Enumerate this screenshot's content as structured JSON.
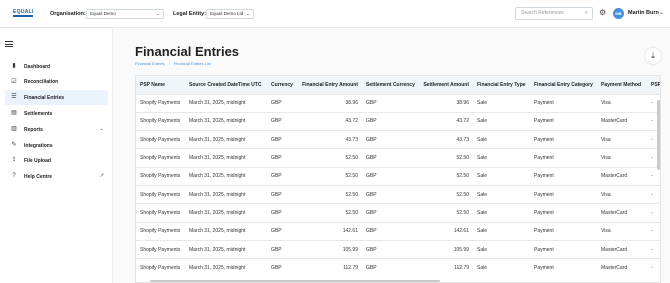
{
  "logo": {
    "text": "EQUALI"
  },
  "header": {
    "org_label": "Organisation:",
    "org_value": "Equali Demo",
    "entity_label": "Legal Entity:",
    "entity_value": "Equali Demo Ltd",
    "search_placeholder": "Search References",
    "user_initials": "MB",
    "user_name": "Martin Burn"
  },
  "sidebar": {
    "items": [
      {
        "label": "Dashboard",
        "icon": "bar-chart-icon",
        "glyph": "▮"
      },
      {
        "label": "Reconciliation",
        "icon": "check-square-icon",
        "glyph": "☑"
      },
      {
        "label": "Financial Entries",
        "icon": "list-icon",
        "glyph": "☰",
        "active": true
      },
      {
        "label": "Settlements",
        "icon": "document-icon",
        "glyph": "▤"
      },
      {
        "label": "Reports",
        "icon": "chart-icon",
        "glyph": "▥",
        "expand": "⌄"
      },
      {
        "label": "Integrations",
        "icon": "plug-icon",
        "glyph": "✎"
      },
      {
        "label": "File Upload",
        "icon": "upload-icon",
        "glyph": "⇪"
      },
      {
        "label": "Help Centre",
        "icon": "help-icon",
        "glyph": "?",
        "expand": "↗"
      }
    ]
  },
  "page": {
    "title": "Financial Entries",
    "breadcrumb": [
      "Financial Entries",
      "Financial Entries List"
    ]
  },
  "table": {
    "columns": [
      "PSP Name",
      "Source Created DateTime UTC",
      "Currency",
      "Financial Entry Amount",
      "Settlement Currency",
      "Settlement Amount",
      "Financial Entry Type",
      "Financial Entry Category",
      "Payment Method",
      "PSP"
    ],
    "rows": [
      [
        "Shopify Payments",
        "March 31, 2025, midnight",
        "GBP",
        "38.96",
        "GBP",
        "38.96",
        "Sale",
        "Payment",
        "Visa",
        "-"
      ],
      [
        "Shopify Payments",
        "March 31, 2025, midnight",
        "GBP",
        "43.72",
        "GBP",
        "43.72",
        "Sale",
        "Payment",
        "MasterCard",
        "-"
      ],
      [
        "Shopify Payments",
        "March 31, 2025, midnight",
        "GBP",
        "43.73",
        "GBP",
        "43.73",
        "Sale",
        "Payment",
        "Visa",
        "-"
      ],
      [
        "Shopify Payments",
        "March 31, 2025, midnight",
        "GBP",
        "52.50",
        "GBP",
        "52.50",
        "Sale",
        "Payment",
        "Visa",
        "-"
      ],
      [
        "Shopify Payments",
        "March 31, 2025, midnight",
        "GBP",
        "52.50",
        "GBP",
        "52.50",
        "Sale",
        "Payment",
        "MasterCard",
        "-"
      ],
      [
        "Shopify Payments",
        "March 31, 2025, midnight",
        "GBP",
        "52.50",
        "GBP",
        "52.50",
        "Sale",
        "Payment",
        "Visa",
        "-"
      ],
      [
        "Shopify Payments",
        "March 31, 2025, midnight",
        "GBP",
        "52.50",
        "GBP",
        "52.50",
        "Sale",
        "Payment",
        "MasterCard",
        "-"
      ],
      [
        "Shopify Payments",
        "March 31, 2025, midnight",
        "GBP",
        "142.61",
        "GBP",
        "142.61",
        "Sale",
        "Payment",
        "Visa",
        "-"
      ],
      [
        "Shopify Payments",
        "March 31, 2025, midnight",
        "GBP",
        "105.99",
        "GBP",
        "105.99",
        "Sale",
        "Payment",
        "MasterCard",
        "-"
      ],
      [
        "Shopify Payments",
        "March 31, 2025, midnight",
        "GBP",
        "112.79",
        "GBP",
        "112.79",
        "Sale",
        "Payment",
        "MasterCard",
        "-"
      ]
    ]
  },
  "colors": {
    "accent": "#1a5fa8",
    "link": "#4a90d9",
    "active_bg": "#eaf2fb",
    "header_bg": "#f0f5fa"
  }
}
